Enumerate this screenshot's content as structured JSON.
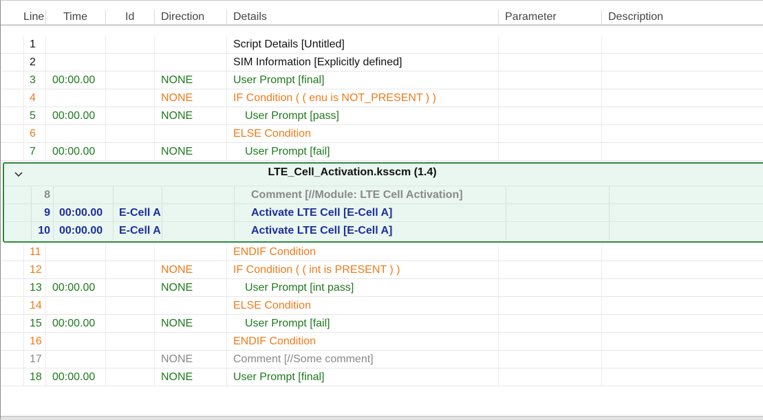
{
  "columns": {
    "line": "Line",
    "time": "Time",
    "id": "Id",
    "direction": "Direction",
    "details": "Details",
    "parameter": "Parameter",
    "description": "Description"
  },
  "rows_top": [
    {
      "line": "1",
      "time": "",
      "id": "",
      "direction": "",
      "details": "Script Details [Untitled]",
      "color": "black",
      "indent": 0
    },
    {
      "line": "2",
      "time": "",
      "id": "",
      "direction": "",
      "details": "SIM Information [Explicitly defined]",
      "color": "black",
      "indent": 0
    },
    {
      "line": "3",
      "time": "00:00.00",
      "id": "",
      "direction": "NONE",
      "details": "User Prompt [final]",
      "color": "green",
      "indent": 0
    },
    {
      "line": "4",
      "time": "",
      "id": "",
      "direction": "NONE",
      "details": "IF Condition ( ( enu is NOT_PRESENT ) )",
      "color": "orange",
      "indent": 0
    },
    {
      "line": "5",
      "time": "00:00.00",
      "id": "",
      "direction": "NONE",
      "details": "User Prompt [pass]",
      "color": "green",
      "indent": 1
    },
    {
      "line": "6",
      "time": "",
      "id": "",
      "direction": "",
      "details": "ELSE Condition",
      "color": "orange",
      "indent": 0
    },
    {
      "line": "7",
      "time": "00:00.00",
      "id": "",
      "direction": "NONE",
      "details": "User Prompt [fail]",
      "color": "green",
      "indent": 1
    }
  ],
  "group": {
    "title": "LTE_Cell_Activation.ksscm (1.4)",
    "rows": [
      {
        "line": "8",
        "time": "",
        "id": "",
        "direction": "",
        "details": "Comment [//Module: LTE Cell Activation]",
        "color": "grayb"
      },
      {
        "line": "9",
        "time": "00:00.00",
        "id": "E-Cell A",
        "direction": "",
        "details": "Activate LTE Cell [E-Cell A]",
        "color": "blue"
      },
      {
        "line": "10",
        "time": "00:00.00",
        "id": "E-Cell A",
        "direction": "",
        "details": "Activate LTE Cell [E-Cell A]",
        "color": "blue"
      }
    ]
  },
  "rows_bottom": [
    {
      "line": "11",
      "time": "",
      "id": "",
      "direction": "",
      "details": "ENDIF Condition",
      "color": "orange",
      "indent": 0
    },
    {
      "line": "12",
      "time": "",
      "id": "",
      "direction": "NONE",
      "details": "IF Condition ( ( int is PRESENT ) )",
      "color": "orange",
      "indent": 0
    },
    {
      "line": "13",
      "time": "00:00.00",
      "id": "",
      "direction": "NONE",
      "details": "User Prompt [int pass]",
      "color": "green",
      "indent": 1
    },
    {
      "line": "14",
      "time": "",
      "id": "",
      "direction": "",
      "details": "ELSE Condition",
      "color": "orange",
      "indent": 0
    },
    {
      "line": "15",
      "time": "00:00.00",
      "id": "",
      "direction": "NONE",
      "details": "User Prompt [fail]",
      "color": "green",
      "indent": 1
    },
    {
      "line": "16",
      "time": "",
      "id": "",
      "direction": "",
      "details": "ENDIF Condition",
      "color": "orange",
      "indent": 0
    },
    {
      "line": "17",
      "time": "",
      "id": "",
      "direction": "NONE",
      "details": "Comment [//Some comment]",
      "color": "gray",
      "indent": 0
    },
    {
      "line": "18",
      "time": "00:00.00",
      "id": "",
      "direction": "NONE",
      "details": "User Prompt [final]",
      "color": "green",
      "indent": 0
    }
  ],
  "colors": {
    "black": "#111111",
    "green": "#1e7a1e",
    "orange": "#f07a1a",
    "gray": "#888888",
    "blue": "#1c2f9c",
    "group_border": "#2e8a3e",
    "group_background": "#eaf6f0"
  },
  "icons": {
    "collapse": "chevron-down-icon"
  }
}
